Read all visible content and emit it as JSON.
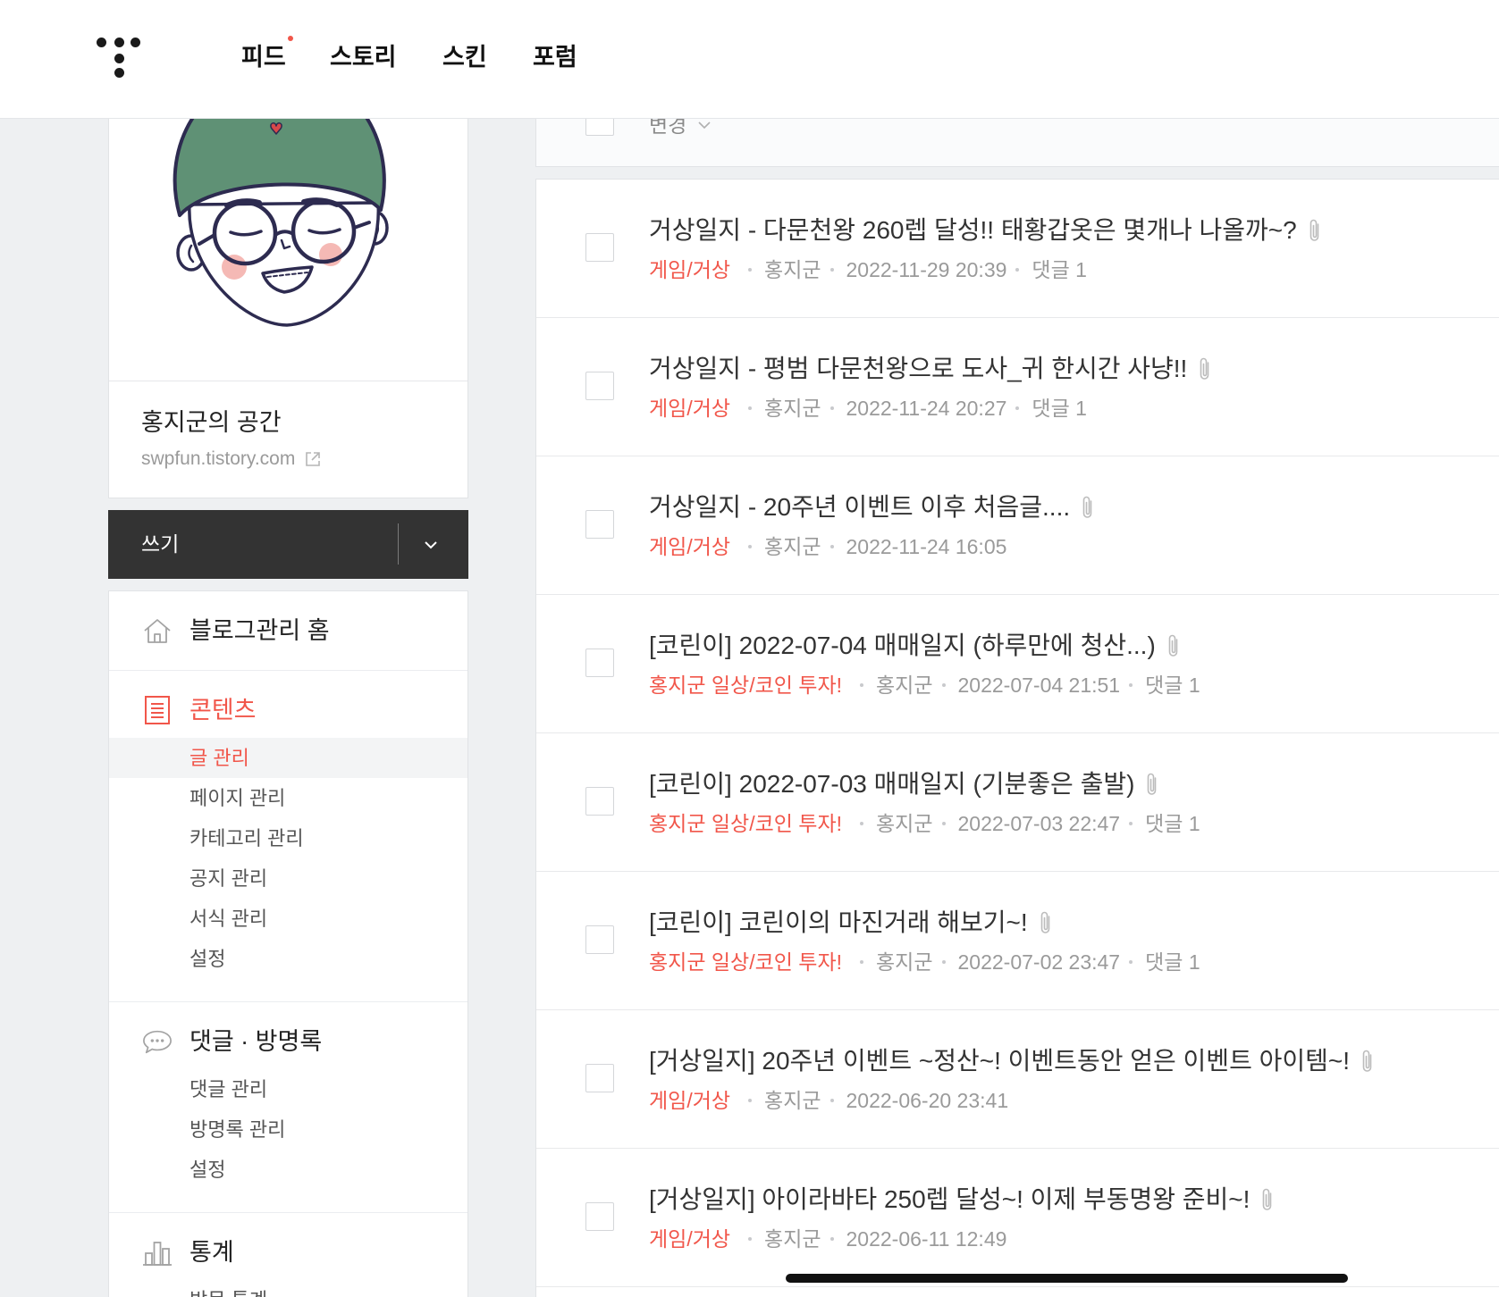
{
  "header": {
    "logo": "tistory-logo",
    "nav": [
      {
        "label": "피드",
        "has_new": true
      },
      {
        "label": "스토리"
      },
      {
        "label": "스킨"
      },
      {
        "label": "포럼"
      }
    ]
  },
  "profile": {
    "blog_name": "홍지군의 공간",
    "blog_url": "swpfun.tistory.com"
  },
  "write_button": {
    "label": "쓰기"
  },
  "menu": {
    "home": {
      "label": "블로그관리 홈"
    },
    "contents": {
      "label": "콘텐츠",
      "items": [
        "글 관리",
        "페이지 관리",
        "카테고리 관리",
        "공지 관리",
        "서식 관리",
        "설정"
      ],
      "active_index": 0
    },
    "comments": {
      "label": "댓글 · 방명록",
      "items": [
        "댓글 관리",
        "방명록 관리",
        "설정"
      ]
    },
    "stats": {
      "label": "통계",
      "items": [
        "방문 통계"
      ]
    }
  },
  "bulk_action": {
    "label": "변경"
  },
  "posts": [
    {
      "title": "거상일지 - 다문천왕 260렙 달성!! 태황갑옷은 몇개나 나올까~?",
      "category": "게임/거상",
      "author": "홍지군",
      "date": "2022-11-29 20:39",
      "comments": "댓글 1",
      "has_attachment": true
    },
    {
      "title": "거상일지 - 평범 다문천왕으로 도사_귀 한시간 사냥!!",
      "category": "게임/거상",
      "author": "홍지군",
      "date": "2022-11-24 20:27",
      "comments": "댓글 1",
      "has_attachment": true
    },
    {
      "title": "거상일지 - 20주년 이벤트 이후 처음글....",
      "category": "게임/거상",
      "author": "홍지군",
      "date": "2022-11-24 16:05",
      "comments": "",
      "has_attachment": true
    },
    {
      "title": "[코린이] 2022-07-04 매매일지 (하루만에 청산...)",
      "category": "홍지군 일상/코인 투자!",
      "author": "홍지군",
      "date": "2022-07-04 21:51",
      "comments": "댓글 1",
      "has_attachment": true
    },
    {
      "title": "[코린이] 2022-07-03 매매일지 (기분좋은 출발)",
      "category": "홍지군 일상/코인 투자!",
      "author": "홍지군",
      "date": "2022-07-03 22:47",
      "comments": "댓글 1",
      "has_attachment": true
    },
    {
      "title": "[코린이] 코린이의 마진거래 해보기~!",
      "category": "홍지군 일상/코인 투자!",
      "author": "홍지군",
      "date": "2022-07-02 23:47",
      "comments": "댓글 1",
      "has_attachment": true
    },
    {
      "title": "[거상일지] 20주년 이벤트 ~정산~! 이벤트동안 얻은 이벤트 아이템~!",
      "category": "게임/거상",
      "author": "홍지군",
      "date": "2022-06-20 23:41",
      "comments": "",
      "has_attachment": true
    },
    {
      "title": "[거상일지] 아이라바타 250렙 달성~! 이제 부동명왕 준비~!",
      "category": "게임/거상",
      "author": "홍지군",
      "date": "2022-06-11 12:49",
      "comments": "",
      "has_attachment": true
    }
  ],
  "icons": {
    "home": "home-icon",
    "contents": "document-icon",
    "comments": "chat-bubble-icon",
    "stats": "bar-chart-icon",
    "external": "external-link-icon",
    "attachment": "paperclip-icon",
    "dropdown": "chevron-down-icon"
  },
  "colors": {
    "accent": "#f1564a",
    "write_button_bg": "#333333",
    "page_background": "#eef0f2",
    "avatar_hat": "#5f9175"
  }
}
